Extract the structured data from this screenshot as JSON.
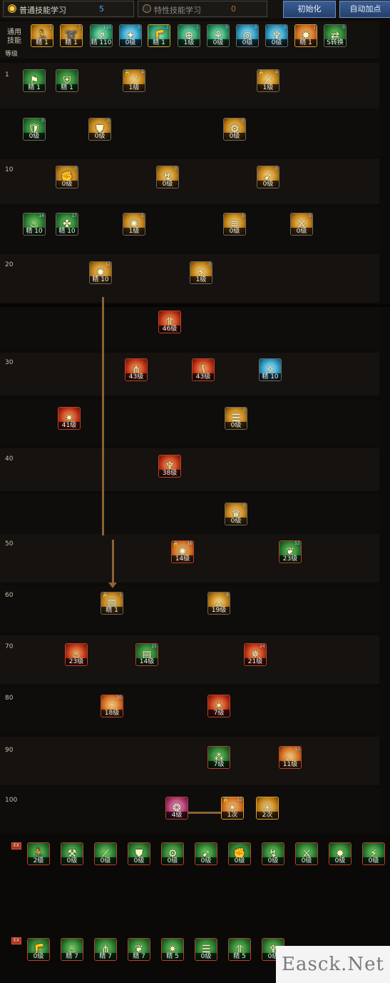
{
  "tabs": [
    {
      "label": "普通技能学习",
      "count": "5",
      "active": true
    },
    {
      "label": "特性技能学习",
      "count": "0",
      "active": false
    }
  ],
  "buttons": {
    "reset": "初始化",
    "auto": "自动加点"
  },
  "general": {
    "label_line1": "通用",
    "label_line2": "技能",
    "level_header": "等级"
  },
  "general_skills": [
    {
      "lv": "精 1",
      "cn": "1"
    },
    {
      "lv": "精 1",
      "cn": "1"
    },
    {
      "lv": "精 110",
      "cn": "110"
    },
    {
      "lv": "0级",
      "cn": "0"
    },
    {
      "lv": "精 1",
      "cn": "1"
    },
    {
      "lv": "1级",
      "cn": "1"
    },
    {
      "lv": "0级",
      "cn": "0"
    },
    {
      "lv": "0级",
      "cn": "0"
    },
    {
      "lv": "0级",
      "cn": "0"
    },
    {
      "lv": "精 1",
      "cn": "1"
    },
    {
      "lv": "S转换",
      "cn": "0"
    }
  ],
  "levels": [
    "1",
    "10",
    "20",
    "30",
    "40",
    "50",
    "60",
    "70",
    "80",
    "90",
    "100"
  ],
  "tree": [
    {
      "lv": "精 1",
      "cn": ""
    },
    {
      "lv": "精 1",
      "cn": ""
    },
    {
      "lv": "1级",
      "cn": "4"
    },
    {
      "lv": "1级",
      "cn": "4"
    },
    {
      "lv": "0级",
      "cn": "0"
    },
    {
      "lv": "0级",
      "cn": "0"
    },
    {
      "lv": "0级",
      "cn": "0"
    },
    {
      "lv": "0级",
      "cn": "0"
    },
    {
      "lv": "0级",
      "cn": "0"
    },
    {
      "lv": "0级",
      "cn": "0"
    },
    {
      "lv": "精 10",
      "cn": "14"
    },
    {
      "lv": "精 10",
      "cn": "17"
    },
    {
      "lv": "1级",
      "cn": "5"
    },
    {
      "lv": "0级",
      "cn": "0"
    },
    {
      "lv": "0级",
      "cn": "0"
    },
    {
      "lv": "精 10",
      "cn": "12"
    },
    {
      "lv": "1级",
      "cn": "3"
    },
    {
      "lv": "46级",
      "cn": ""
    },
    {
      "lv": "43级",
      "cn": ""
    },
    {
      "lv": "43级",
      "cn": ""
    },
    {
      "lv": "精 10",
      "cn": ""
    },
    {
      "lv": "41级",
      "cn": ""
    },
    {
      "lv": "0级",
      "cn": "0"
    },
    {
      "lv": "38级",
      "cn": ""
    },
    {
      "lv": "0级",
      "cn": "0"
    },
    {
      "lv": "14级",
      "cn": "16"
    },
    {
      "lv": "23级",
      "cn": "53"
    },
    {
      "lv": "精 1",
      "cn": "1"
    },
    {
      "lv": "19级",
      "cn": "8"
    },
    {
      "lv": "23级",
      "cn": ""
    },
    {
      "lv": "14级",
      "cn": "15"
    },
    {
      "lv": "21级",
      "cn": "24"
    },
    {
      "lv": "18级",
      "cn": "20"
    },
    {
      "lv": "7级",
      "cn": ""
    },
    {
      "lv": "7级",
      "cn": ""
    },
    {
      "lv": "11级",
      "cn": "13"
    },
    {
      "lv": "4级",
      "cn": ""
    },
    {
      "lv": "1次",
      "cn": "10"
    },
    {
      "lv": "2次",
      "cn": ""
    }
  ],
  "bottom_row1": [
    {
      "lv": "2级"
    },
    {
      "lv": "0级"
    },
    {
      "lv": "0级"
    },
    {
      "lv": "0级"
    },
    {
      "lv": "0级"
    },
    {
      "lv": "0级"
    },
    {
      "lv": "0级"
    },
    {
      "lv": "0级"
    },
    {
      "lv": "0级"
    },
    {
      "lv": "0级"
    },
    {
      "lv": "0级"
    }
  ],
  "bottom_row2": [
    {
      "lv": "0级"
    },
    {
      "lv": "精 7"
    },
    {
      "lv": "精 7"
    },
    {
      "lv": "精 7"
    },
    {
      "lv": "精 5"
    },
    {
      "lv": "0级"
    },
    {
      "lv": "精 5"
    },
    {
      "lv": "0级"
    },
    {
      "lv": ""
    },
    {
      "lv": ""
    }
  ],
  "watermark": "Easck.Net"
}
